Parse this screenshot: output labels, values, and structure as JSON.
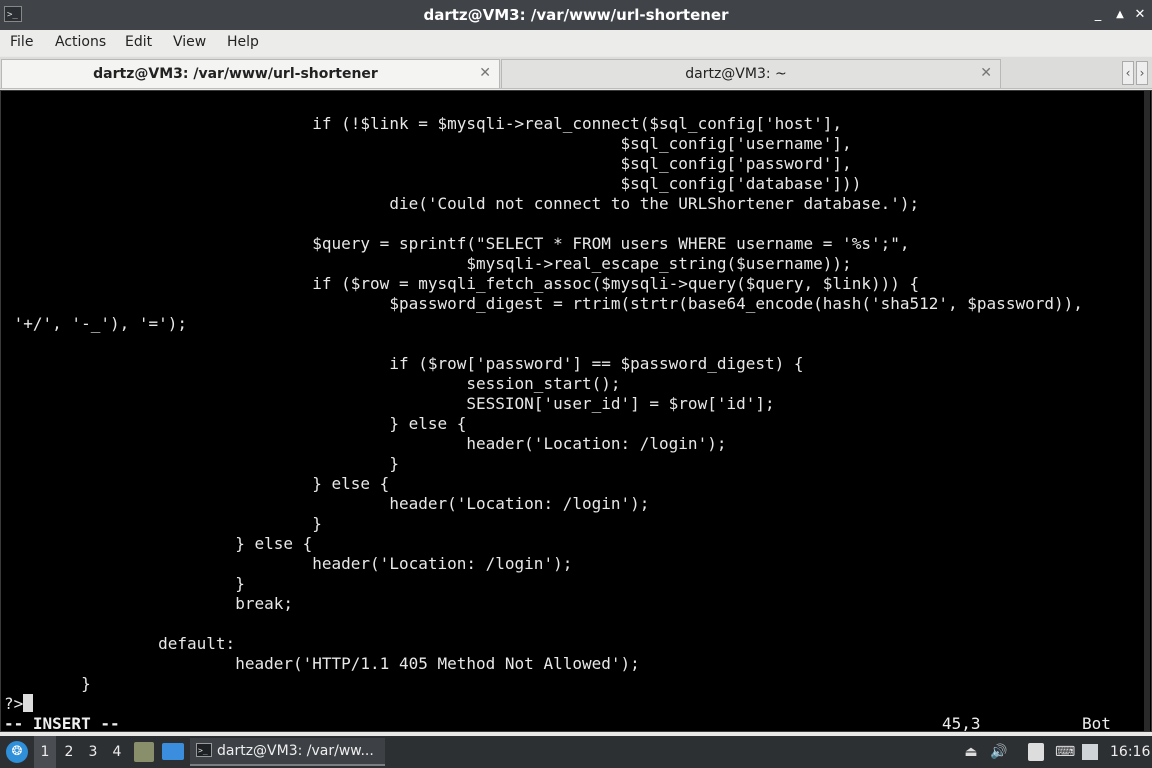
{
  "window": {
    "title": "dartz@VM3: /var/www/url-shortener",
    "app_icon": "terminal-icon",
    "controls": {
      "minimize": "_",
      "maximize": "▲",
      "close": "✕"
    }
  },
  "menu": {
    "items": [
      "File",
      "Actions",
      "Edit",
      "View",
      "Help"
    ]
  },
  "tabs": [
    {
      "label": "dartz@VM3: /var/www/url-shortener",
      "active": true,
      "close": "✕"
    },
    {
      "label": "dartz@VM3: ~",
      "active": false,
      "close": "✕"
    }
  ],
  "tab_scroll": {
    "left": "‹",
    "right": "›"
  },
  "terminal": {
    "lines": [
      "                                if (!$link = $mysqli->real_connect($sql_config['host'],",
      "                                                                $sql_config['username'],",
      "                                                                $sql_config['password'],",
      "                                                                $sql_config['database']))",
      "                                        die('Could not connect to the URLShortener database.');",
      "",
      "                                $query = sprintf(\"SELECT * FROM users WHERE username = '%s';\",",
      "                                                $mysqli->real_escape_string($username));",
      "                                if ($row = mysqli_fetch_assoc($mysqli->query($query, $link))) {",
      "                                        $password_digest = rtrim(strtr(base64_encode(hash('sha512', $password)),",
      " '+/', '-_'), '=');",
      "",
      "                                        if ($row['password'] == $password_digest) {",
      "                                                session_start();",
      "                                                SESSION['user_id'] = $row['id'];",
      "                                        } else {",
      "                                                header('Location: /login');",
      "                                        }",
      "                                } else {",
      "                                        header('Location: /login');",
      "                                }",
      "                        } else {",
      "                                header('Location: /login');",
      "                        }",
      "                        break;",
      "",
      "                default:",
      "                        header('HTTP/1.1 405 Method Not Allowed');",
      "        }",
      "?>"
    ],
    "mode": "-- INSERT --",
    "cursor_position": "45,3",
    "scroll_position": "Bot"
  },
  "taskbar": {
    "start_icon": "menu-logo-icon",
    "workspaces": [
      "1",
      "2",
      "3",
      "4"
    ],
    "active_workspace": "1",
    "launchers": [
      "file-manager-icon",
      "desktop-icon"
    ],
    "task": {
      "label": "dartz@VM3: /var/ww...",
      "icon": "terminal-icon"
    },
    "tray_icons": [
      "eject-icon",
      "volume-icon",
      "notes-icon",
      "keyboard-icon",
      "network-icon"
    ],
    "clock": "16:16"
  }
}
